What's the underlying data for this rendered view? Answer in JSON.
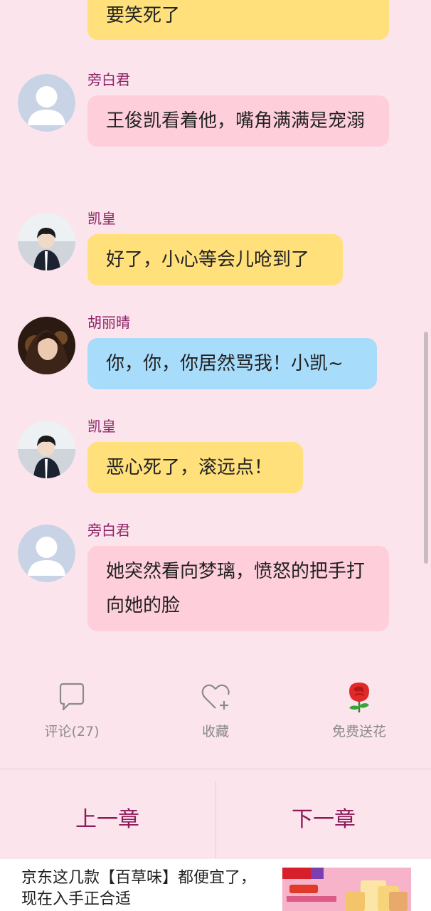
{
  "messages": [
    {
      "speaker": "",
      "avatar": "none",
      "text": "要笑死了",
      "style": "yellow"
    },
    {
      "speaker": "旁白君",
      "avatar": "default-avatar",
      "text": "王俊凯看着他，嘴角满满是宠溺",
      "style": "narration"
    },
    {
      "speaker": "凯皇",
      "avatar": "boy-avatar",
      "text": "好了，小心等会儿呛到了",
      "style": "yellow"
    },
    {
      "speaker": "胡丽晴",
      "avatar": "girl-avatar",
      "text": "你，你，你居然骂我！小凯~",
      "style": "blue"
    },
    {
      "speaker": "凯皇",
      "avatar": "boy-avatar",
      "text": "恶心死了，滚远点！",
      "style": "yellow"
    },
    {
      "speaker": "旁白君",
      "avatar": "default-avatar",
      "text": "她突然看向梦璃，愤怒的把手打向她的脸",
      "style": "narration"
    }
  ],
  "actions": {
    "comment": {
      "label": "评论(27)",
      "icon": "comment-icon"
    },
    "favorite": {
      "label": "收藏",
      "icon": "heart-plus-icon"
    },
    "flower": {
      "label": "免费送花",
      "icon": "rose-icon"
    }
  },
  "chapter_nav": {
    "prev": "上一章",
    "next": "下一章"
  },
  "ad": {
    "text": "京东这几款【百草味】都便宜了，现在入手正合适",
    "image": "bcw-ad-image"
  },
  "colors": {
    "background": "#fce4ec",
    "narration_bubble": "#ffcedb",
    "yellow_bubble": "#ffe07a",
    "blue_bubble": "#a8dcfb",
    "speaker_name": "#8e2468",
    "chapter_button": "#8e1a5a"
  }
}
